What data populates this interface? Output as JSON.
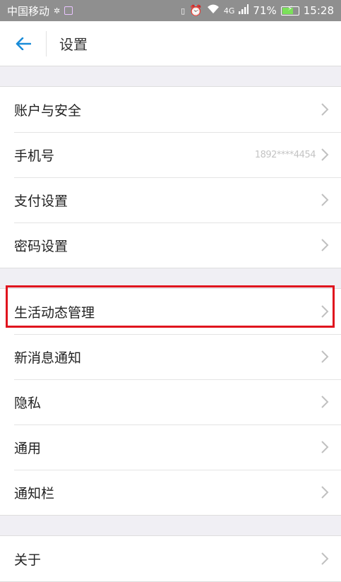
{
  "status_bar": {
    "carrier": "中国移动",
    "network": "4G",
    "battery": "71%",
    "battery_level": 0.71,
    "time": "15:28"
  },
  "header": {
    "title": "设置"
  },
  "groups": [
    {
      "items": [
        {
          "label": "账户与安全"
        },
        {
          "label": "手机号",
          "value": "1892****4454"
        },
        {
          "label": "支付设置"
        },
        {
          "label": "密码设置"
        }
      ]
    },
    {
      "items": [
        {
          "label": "生活动态管理"
        },
        {
          "label": "新消息通知"
        },
        {
          "label": "隐私"
        },
        {
          "label": "通用"
        },
        {
          "label": "通知栏"
        }
      ]
    },
    {
      "items": [
        {
          "label": "关于"
        }
      ]
    }
  ],
  "colors": {
    "accent": "#1a8cd8",
    "highlight": "#e0141e",
    "status_bar": "#8f8f8f"
  }
}
